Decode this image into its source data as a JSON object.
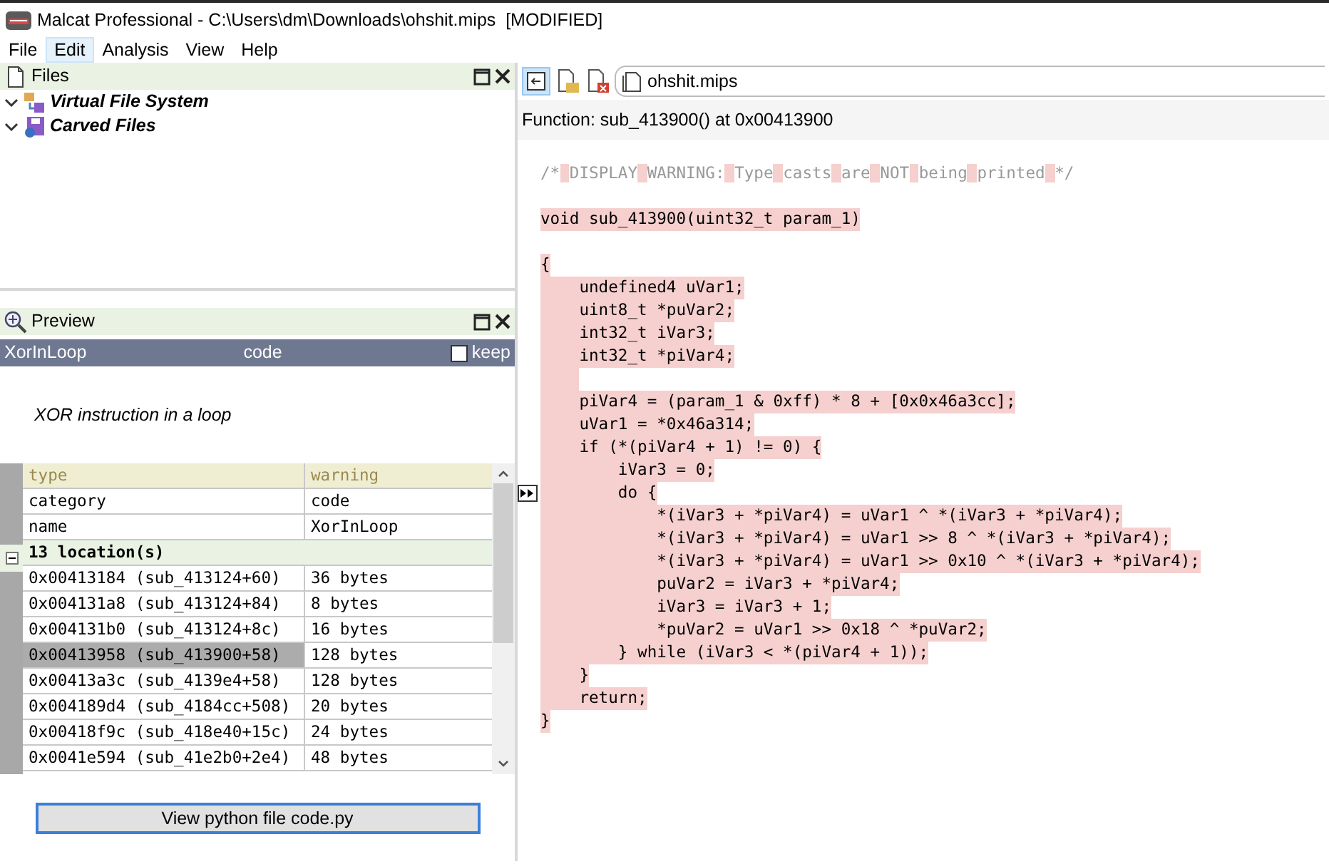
{
  "window": {
    "title": "Malcat Professional - C:\\Users\\dm\\Downloads\\ohshit.mips  [MODIFIED]"
  },
  "menu": [
    {
      "label": "File",
      "selected": false
    },
    {
      "label": "Edit",
      "selected": true
    },
    {
      "label": "Analysis",
      "selected": false
    },
    {
      "label": "View",
      "selected": false
    },
    {
      "label": "Help",
      "selected": false
    }
  ],
  "files_panel": {
    "title": "Files",
    "tree": [
      {
        "kind": "vfs",
        "label": "Virtual File System",
        "expanded": true
      },
      {
        "kind": "carved",
        "label": "Carved Files",
        "expanded": true
      }
    ]
  },
  "preview_panel": {
    "title": "Preview",
    "header": {
      "name": "XorInLoop",
      "category": "code",
      "keep": {
        "label": "keep",
        "checked": false
      }
    },
    "description": "XOR instruction in a loop",
    "table": {
      "columns": [
        "type",
        "warning"
      ],
      "rows": [
        [
          "category",
          "code"
        ],
        [
          "name",
          "XorInLoop"
        ]
      ],
      "group": {
        "label": "13 location(s)",
        "expanded": true,
        "rows": [
          {
            "address": "0x00413184 (sub_413124+60)",
            "size": "36 bytes",
            "selected": false
          },
          {
            "address": "0x004131a8 (sub_413124+84)",
            "size": "8 bytes",
            "selected": false
          },
          {
            "address": "0x004131b0 (sub_413124+8c)",
            "size": "16 bytes",
            "selected": false
          },
          {
            "address": "0x00413958 (sub_413900+58)",
            "size": "128 bytes",
            "selected": true
          },
          {
            "address": "0x00413a3c (sub_4139e4+58)",
            "size": "128 bytes",
            "selected": false
          },
          {
            "address": "0x004189d4 (sub_4184cc+508)",
            "size": "20 bytes",
            "selected": false
          },
          {
            "address": "0x00418f9c (sub_418e40+15c)",
            "size": "24 bytes",
            "selected": false
          },
          {
            "address": "0x0041e594 (sub_41e2b0+2e4)",
            "size": "48 bytes",
            "selected": false
          }
        ]
      }
    },
    "button": "View python file code.py"
  },
  "editor": {
    "tab": "ohshit.mips",
    "function_label": "Function: sub_413900() at 0x00413900",
    "lines": [
      {
        "kind": "comment",
        "text": "/* DISPLAY WARNING: Type casts are NOT being printed */"
      },
      {
        "kind": "blank"
      },
      {
        "kind": "code",
        "text": "void sub_413900(uint32_t param_1)",
        "highlighted": true
      },
      {
        "kind": "blank"
      },
      {
        "kind": "code",
        "text": "{",
        "highlighted": true
      },
      {
        "kind": "code",
        "text": "    undefined4 uVar1;",
        "highlighted": true
      },
      {
        "kind": "code",
        "text": "    uint8_t *puVar2;",
        "highlighted": true
      },
      {
        "kind": "code",
        "text": "    int32_t iVar3;",
        "highlighted": true
      },
      {
        "kind": "code",
        "text": "    int32_t *piVar4;",
        "highlighted": true
      },
      {
        "kind": "blank",
        "highlighted": true
      },
      {
        "kind": "code",
        "text": "    piVar4 = (param_1 & 0xff) * 8 + [0x0x46a3cc];",
        "highlighted": true
      },
      {
        "kind": "code",
        "text": "    uVar1 = *0x46a314;",
        "highlighted": true
      },
      {
        "kind": "code",
        "text": "    if (*(piVar4 + 1) != 0) {",
        "highlighted": true
      },
      {
        "kind": "code",
        "text": "        iVar3 = 0;",
        "highlighted": true
      },
      {
        "kind": "code",
        "text": "        do {",
        "highlighted": true,
        "marker": true
      },
      {
        "kind": "code",
        "text": "            *(iVar3 + *piVar4) = uVar1 ^ *(iVar3 + *piVar4);",
        "highlighted": true
      },
      {
        "kind": "code",
        "text": "            *(iVar3 + *piVar4) = uVar1 >> 8 ^ *(iVar3 + *piVar4);",
        "highlighted": true
      },
      {
        "kind": "code",
        "text": "            *(iVar3 + *piVar4) = uVar1 >> 0x10 ^ *(iVar3 + *piVar4);",
        "highlighted": true
      },
      {
        "kind": "code",
        "text": "            puVar2 = iVar3 + *piVar4;",
        "highlighted": true
      },
      {
        "kind": "code",
        "text": "            iVar3 = iVar3 + 1;",
        "highlighted": true
      },
      {
        "kind": "code",
        "text": "            *puVar2 = uVar1 >> 0x18 ^ *puVar2;",
        "highlighted": true
      },
      {
        "kind": "code",
        "text": "        } while (iVar3 < *(piVar4 + 1));",
        "highlighted": true
      },
      {
        "kind": "code",
        "text": "    }",
        "highlighted": true
      },
      {
        "kind": "code",
        "text": "    return;",
        "highlighted": true
      },
      {
        "kind": "code",
        "text": "}",
        "highlighted": true
      }
    ]
  }
}
